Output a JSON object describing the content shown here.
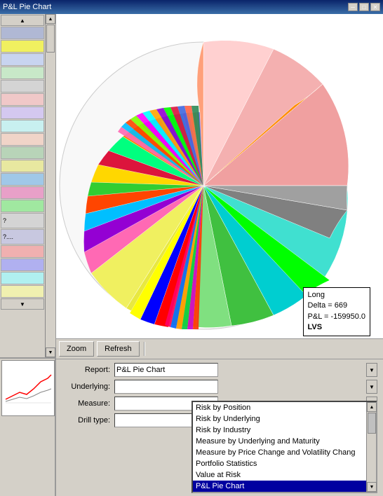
{
  "titleBar": {
    "title": "P&L Pie Chart",
    "minBtn": "─",
    "maxBtn": "□",
    "closeBtn": "✕"
  },
  "controls": {
    "zoomLabel": "Zoom",
    "refreshLabel": "Refresh"
  },
  "form": {
    "reportLabel": "Report:",
    "underlyingLabel": "Underlying:",
    "measureLabel": "Measure:",
    "drillLabel": "Drill type:",
    "reportValue": "P&L Pie Chart"
  },
  "dropdown": {
    "options": [
      {
        "label": "Risk by Position",
        "selected": false
      },
      {
        "label": "Risk by Underlying",
        "selected": false
      },
      {
        "label": "Risk by Industry",
        "selected": false
      },
      {
        "label": "Measure by Underlying and Maturity",
        "selected": false
      },
      {
        "label": "Measure by Price Change and Volatility Chang",
        "selected": false
      },
      {
        "label": "Portfolio Statistics",
        "selected": false
      },
      {
        "label": "Value at Risk",
        "selected": false
      },
      {
        "label": "P&L Pie Chart",
        "selected": true
      }
    ]
  },
  "tooltip": {
    "line1": "Long",
    "line2": "Delta = 669",
    "line3": "P&L = -159950.0",
    "line4bold": "LVS"
  },
  "sidebarItems": [
    {
      "label": "..."
    },
    {
      "label": ""
    },
    {
      "label": ""
    },
    {
      "label": "?"
    },
    {
      "label": "?...."
    }
  ],
  "colors": {
    "titleBg": "#0a246a",
    "selectedBg": "#0000a0",
    "selectedFg": "#ffffff"
  }
}
